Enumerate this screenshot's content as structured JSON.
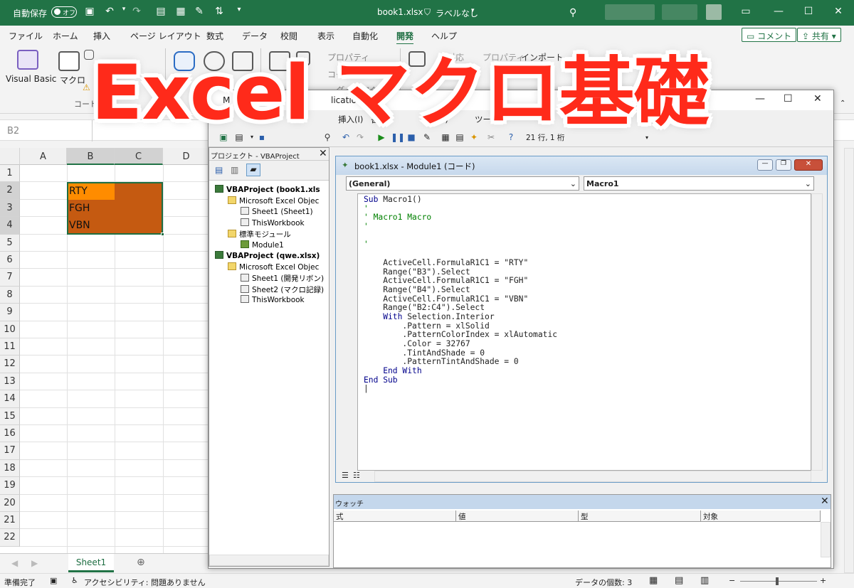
{
  "excel": {
    "autosave": "自動保存",
    "autosave_state": "オフ",
    "doc_title": "book1.xlsx",
    "label_status": "ラベルなし",
    "tabs": [
      "ファイル",
      "ホーム",
      "挿入",
      "ページ レイアウト",
      "数式",
      "データ",
      "校閲",
      "表示",
      "自動化",
      "開発",
      "ヘルプ"
    ],
    "active_tab": "開発",
    "comment_btn": "コメント",
    "share_btn": "共有",
    "ribbon": {
      "vb": "Visual Basic",
      "macro": "マクロ",
      "code_group": "コード",
      "properties": "プロパティ",
      "view_code": "コードの",
      "dialog": "ダイアログ",
      "import": "インポート",
      "properties2": "プロパティ",
      "map": "対応"
    },
    "namebox": "B2",
    "columns": [
      "A",
      "B",
      "C",
      "D"
    ],
    "rows": [
      "1",
      "2",
      "3",
      "4",
      "5",
      "6",
      "7",
      "8",
      "9",
      "10",
      "11",
      "12",
      "13",
      "14",
      "15",
      "16",
      "17",
      "18",
      "19",
      "20",
      "21",
      "22"
    ],
    "cells": {
      "b2": "RTY",
      "b3": "FGH",
      "b4": "VBN"
    },
    "sheet_tab": "Sheet1",
    "status_ready": "準備完了",
    "accessibility": "アクセシビリティ: 問題ありません",
    "data_count": "データの個数: 3",
    "colors": {
      "accent": "#217346",
      "fill_dark": "#c55a11",
      "fill_orange": "#ff8c00"
    }
  },
  "vbe": {
    "title_fragment": "lications -",
    "title_prefix": "M",
    "menus": [
      "挿入(I)",
      "書式",
      "ッグ(D)",
      "ツール("
    ],
    "position": "21 行, 1 桁",
    "project_title": "プロジェクト - VBAProject",
    "tree": [
      {
        "label": "VBAProject (book1.xls",
        "level": 0,
        "type": "proj",
        "bold": true
      },
      {
        "label": "Microsoft Excel Objec",
        "level": 1,
        "type": "folder"
      },
      {
        "label": "Sheet1 (Sheet1)",
        "level": 2,
        "type": "sheet"
      },
      {
        "label": "ThisWorkbook",
        "level": 2,
        "type": "sheet"
      },
      {
        "label": "標準モジュール",
        "level": 1,
        "type": "folder"
      },
      {
        "label": "Module1",
        "level": 2,
        "type": "mod"
      },
      {
        "label": "VBAProject (qwe.xlsx)",
        "level": 0,
        "type": "proj",
        "bold": true
      },
      {
        "label": "Microsoft Excel Objec",
        "level": 1,
        "type": "folder"
      },
      {
        "label": "Sheet1 (開発リボン)",
        "level": 2,
        "type": "sheet"
      },
      {
        "label": "Sheet2 (マクロ記録)",
        "level": 2,
        "type": "sheet"
      },
      {
        "label": "ThisWorkbook",
        "level": 2,
        "type": "sheet"
      }
    ],
    "code_title": "book1.xlsx - Module1 (コード)",
    "combo_left": "(General)",
    "combo_right": "Macro1",
    "code_lines": [
      {
        "t": "kw",
        "s": "Sub",
        "r": " Macro1()"
      },
      {
        "t": "cm",
        "s": "'"
      },
      {
        "t": "cm",
        "s": "' Macro1 Macro"
      },
      {
        "t": "cm",
        "s": "'"
      },
      {
        "t": "",
        "s": ""
      },
      {
        "t": "cm",
        "s": "'"
      },
      {
        "t": "",
        "s": ""
      },
      {
        "t": "",
        "s": "    ActiveCell.FormulaR1C1 = \"RTY\""
      },
      {
        "t": "",
        "s": "    Range(\"B3\").Select"
      },
      {
        "t": "",
        "s": "    ActiveCell.FormulaR1C1 = \"FGH\""
      },
      {
        "t": "",
        "s": "    Range(\"B4\").Select"
      },
      {
        "t": "",
        "s": "    ActiveCell.FormulaR1C1 = \"VBN\""
      },
      {
        "t": "",
        "s": "    Range(\"B2:C4\").Select"
      },
      {
        "t": "kw2",
        "s": "    With",
        "r": " Selection.Interior"
      },
      {
        "t": "",
        "s": "        .Pattern = xlSolid"
      },
      {
        "t": "",
        "s": "        .PatternColorIndex = xlAutomatic"
      },
      {
        "t": "",
        "s": "        .Color = 32767"
      },
      {
        "t": "",
        "s": "        .TintAndShade = 0"
      },
      {
        "t": "",
        "s": "        .PatternTintAndShade = 0"
      },
      {
        "t": "kw",
        "s": "    End With",
        "r": ""
      },
      {
        "t": "kw",
        "s": "End Sub",
        "r": ""
      },
      {
        "t": "",
        "s": "|"
      }
    ],
    "watch_title": "ウォッチ",
    "watch_cols": [
      "式",
      "値",
      "型",
      "対象"
    ]
  },
  "overlay_title": "Excel マクロ基礎"
}
